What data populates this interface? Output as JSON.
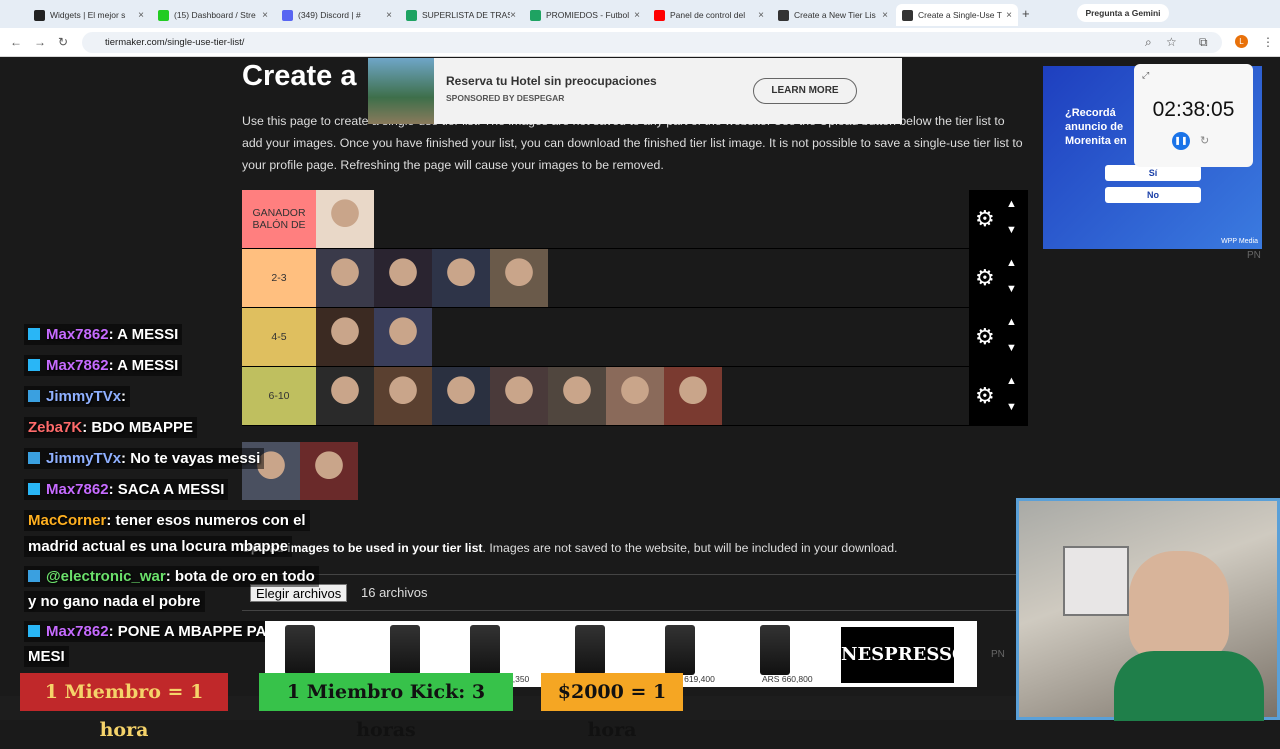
{
  "browser": {
    "tabs": [
      {
        "label": "Widgets | El mejor s",
        "color": "#222"
      },
      {
        "label": "(15) Dashboard / Stre",
        "color": "#2c2"
      },
      {
        "label": "(349) Discord | #",
        "color": "#5865f2"
      },
      {
        "label": "SUPERLISTA DE TRAS",
        "color": "#1ea362"
      },
      {
        "label": "PROMIEDOS - Futbol",
        "color": "#1ea362"
      },
      {
        "label": "Panel de control del",
        "color": "#f00"
      },
      {
        "label": "Create a New Tier Lis",
        "color": "#333"
      },
      {
        "label": "Create a Single-Use T",
        "color": "#333"
      }
    ],
    "gemini": "Pregunta a Gemini",
    "url": "tiermaker.com/single-use-tier-list/"
  },
  "page": {
    "title": "Create a",
    "intro": "Use this page to create a single-use tier list. The images are not saved to any part of the website. Use the Upload button below the tier list to add your images. Once you have finished your list, you can download the finished tier list image. It is not possible to save a single-use tier list to your profile page. Refreshing the page will cause your images to be removed.",
    "upload_bold": "Upload images to be used in your tier list",
    "upload_rest": ". Images are not saved to the website, but will be included in your download.",
    "file_button": "Elegir archivos",
    "file_count": "16 archivos"
  },
  "ad_top": {
    "headline": "Reserva tu Hotel sin preocupaciones",
    "sponsor": "SPONSORED BY DESPEGAR",
    "cta": "LEARN MORE"
  },
  "tiers": [
    {
      "label": "GANADOR BALÓN DE",
      "color": "#ff7f7f",
      "items": [
        "#e9d8c8"
      ]
    },
    {
      "label": "2-3",
      "color": "#ffbf7f",
      "items": [
        "#3a3a4a",
        "#2a2430",
        "#2e3448",
        "#6a5a4a"
      ]
    },
    {
      "label": "4-5",
      "color": "#dfbf5f",
      "items": [
        "#3b2a22",
        "#3a3e5a"
      ]
    },
    {
      "label": "6-10",
      "color": "#bfbf5f",
      "items": [
        "#2a2a2a",
        "#5a4030",
        "#2a3040",
        "#4a3a3a",
        "#50463e",
        "#8a6a5a",
        "#7a3a30"
      ]
    }
  ],
  "pool_items": [
    "#4a5060",
    "#6a2a2a"
  ],
  "chat": [
    {
      "user": "Max7862",
      "msg": ": A MESSI",
      "color": "#c66bff",
      "badge": "#29b6f6"
    },
    {
      "user": "Max7862",
      "msg": ": A MESSI",
      "color": "#c66bff",
      "badge": "#29b6f6"
    },
    {
      "user": "JimmyTVx",
      "msg": ":",
      "color": "#8fb0ff",
      "badge": "#3aa0e0"
    },
    {
      "user": "Zeba7K",
      "msg": ": BDO MBAPPE",
      "color": "#ff6b6b",
      "badge": ""
    },
    {
      "user": "JimmyTVx",
      "msg": ": No te vayas messi",
      "color": "#8fb0ff",
      "badge": "#3aa0e0"
    },
    {
      "user": "Max7862",
      "msg": ": SACA A MESSI",
      "color": "#c66bff",
      "badge": "#29b6f6"
    },
    {
      "user": "MacCorner",
      "msg": ": tener esos numeros con el",
      "color": "#ffb020",
      "badge": ""
    },
    {
      "user": "",
      "msg": "madrid actual es una locura mbappe",
      "color": "#fff",
      "badge": ""
    },
    {
      "user": "@electronic_war",
      "msg": ": bota de oro en todo",
      "color": "#6be06b",
      "badge": "#3aa0e0"
    },
    {
      "user": "",
      "msg": "y no gano nada el pobre",
      "color": "#fff",
      "badge": ""
    },
    {
      "user": "Max7862",
      "msg": ": PONE A MBAPPE PARA",
      "color": "#c66bff",
      "badge": "#29b6f6"
    },
    {
      "user": "",
      "msg": "MESI",
      "color": "#fff",
      "badge": ""
    }
  ],
  "right_ad": {
    "question": "¿Recordá anuncio de Morenita en",
    "yes": "Sí",
    "no": "No",
    "brand": "WPP Media"
  },
  "timer": {
    "value": "02:38:05"
  },
  "bottom_ad": {
    "prices": [
      "4,350",
      "$ 619,400",
      "ARS 660,800"
    ],
    "brand": "NESPRESSO"
  },
  "banners": [
    {
      "text": "1 Miembro = 1 hora",
      "bg": "#c0282a",
      "fg": "#f5d36a"
    },
    {
      "text": "1 Miembro Kick: 3 horas",
      "bg": "#37c24a",
      "fg": "#111"
    },
    {
      "text": "$2000 = 1 hora",
      "bg": "#f5a623",
      "fg": "#111"
    }
  ],
  "pn": "PN"
}
